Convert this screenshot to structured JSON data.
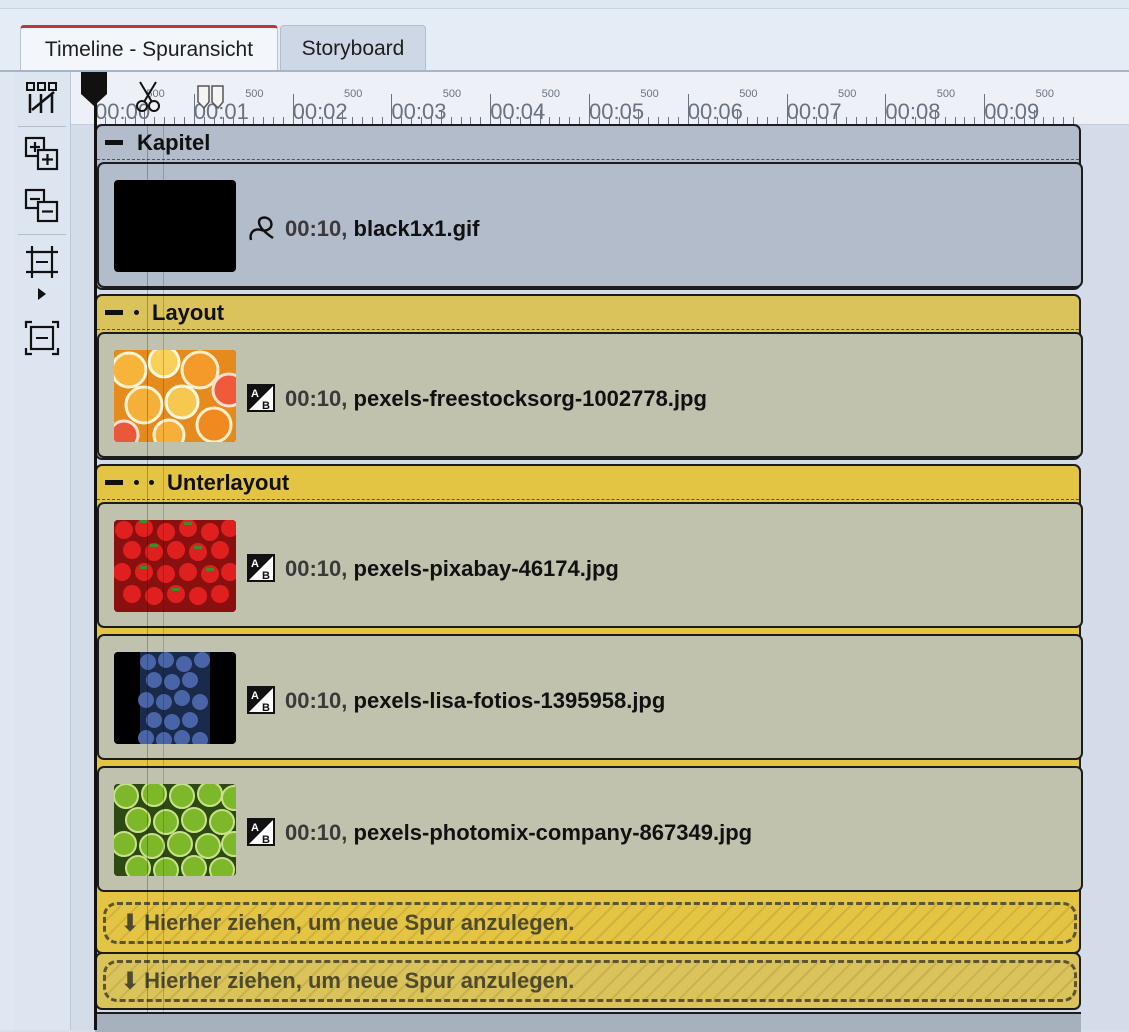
{
  "tabs": [
    {
      "label": "Timeline - Spuransicht",
      "active": true
    },
    {
      "label": "Storyboard",
      "active": false
    }
  ],
  "toolbar": {
    "icons": [
      "insert-track-icon",
      "add-group-icon",
      "remove-group-icon",
      "fit-timeline-icon",
      "expand-collapse-icon"
    ]
  },
  "ruler": {
    "times": [
      "00:00",
      "00:01",
      "00:02",
      "00:03",
      "00:04",
      "00:05",
      "00:06",
      "00:07",
      "00:08",
      "00:09"
    ],
    "half_label": "500"
  },
  "groups": [
    {
      "title": "Kapitel",
      "level": 0,
      "color": "#b2bcca",
      "clips": [
        {
          "duration": "00:10,",
          "filename": "black1x1.gif",
          "icon": "motion-path-icon",
          "thumb": "black"
        }
      ]
    },
    {
      "title": "Layout",
      "level": 1,
      "color": "#d9c35a",
      "clips": [
        {
          "duration": "00:10,",
          "filename": "pexels-freestocksorg-1002778.jpg",
          "icon": "image-ab-icon",
          "thumb": "oranges"
        }
      ]
    },
    {
      "title": "Unterlayout",
      "level": 2,
      "color": "#e4c443",
      "clips": [
        {
          "duration": "00:10,",
          "filename": "pexels-pixabay-46174.jpg",
          "icon": "image-ab-icon",
          "thumb": "strawberries"
        },
        {
          "duration": "00:10,",
          "filename": "pexels-lisa-fotios-1395958.jpg",
          "icon": "image-ab-icon",
          "thumb": "blueberries"
        },
        {
          "duration": "00:10,",
          "filename": "pexels-photomix-company-867349.jpg",
          "icon": "image-ab-icon",
          "thumb": "kiwis"
        }
      ]
    }
  ],
  "dropzones": [
    {
      "label": "Hierher ziehen, um neue Spur anzulegen."
    },
    {
      "label": "Hierher ziehen, um neue Spur anzulegen."
    }
  ],
  "colors": {
    "active_tab_accent": "#c0343a",
    "kapitel": "#b2bcca",
    "layout": "#d9c35a",
    "unterlayout": "#e4c443",
    "clip_bg": "#c0c2ae"
  }
}
